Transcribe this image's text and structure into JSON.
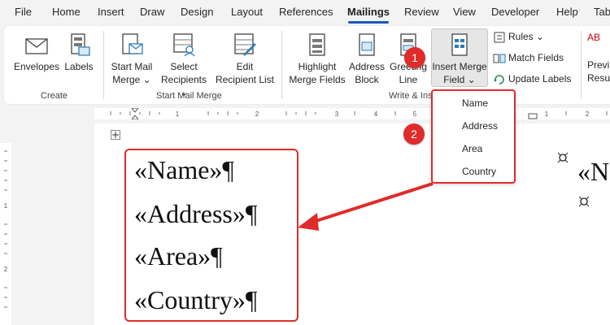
{
  "tabs": [
    "File",
    "Home",
    "Insert",
    "Draw",
    "Design",
    "Layout",
    "References",
    "Mailings",
    "Review",
    "View",
    "Developer",
    "Help",
    "Tab"
  ],
  "active_tab": "Mailings",
  "ribbon": {
    "create": {
      "envelopes": "Envelopes",
      "labels": "Labels",
      "group": "Create"
    },
    "start_mail_merge": {
      "start_line1": "Start Mail",
      "start_line2": "Merge",
      "select_line1": "Select",
      "select_line2": "Recipients",
      "edit_line1": "Edit",
      "edit_line2": "Recipient List",
      "group": "Start Mail Merge"
    },
    "write_insert": {
      "highlight_line1": "Highlight",
      "highlight_line2": "Merge Fields",
      "address_line1": "Address",
      "address_line2": "Block",
      "greeting_line1": "Greeting",
      "greeting_line2": "Line",
      "insert_line1": "Insert Merge",
      "insert_line2": "Field",
      "rules": "Rules",
      "match_fields": "Match Fields",
      "update_labels": "Update Labels",
      "group": "Write & Insert Fields"
    },
    "preview": {
      "line1": "Previ",
      "line2": "Resu",
      "abc": "AB"
    }
  },
  "dropdown": {
    "items": [
      "Name",
      "Address",
      "Area",
      "Country"
    ]
  },
  "document": {
    "fields": [
      "«Name»¶",
      "«Address»¶",
      "«Area»¶",
      "«Country»¶"
    ],
    "partial_right": "«N"
  },
  "badges": {
    "one": "1",
    "two": "2"
  },
  "ruler": {
    "marks": [
      "1",
      "2",
      "3",
      "4",
      "5",
      "6",
      "7",
      "1",
      "2"
    ]
  },
  "vruler": {
    "marks": [
      "1",
      "2"
    ]
  },
  "colors": {
    "accent": "#185abd",
    "highlight_red": "#e02b2b"
  }
}
